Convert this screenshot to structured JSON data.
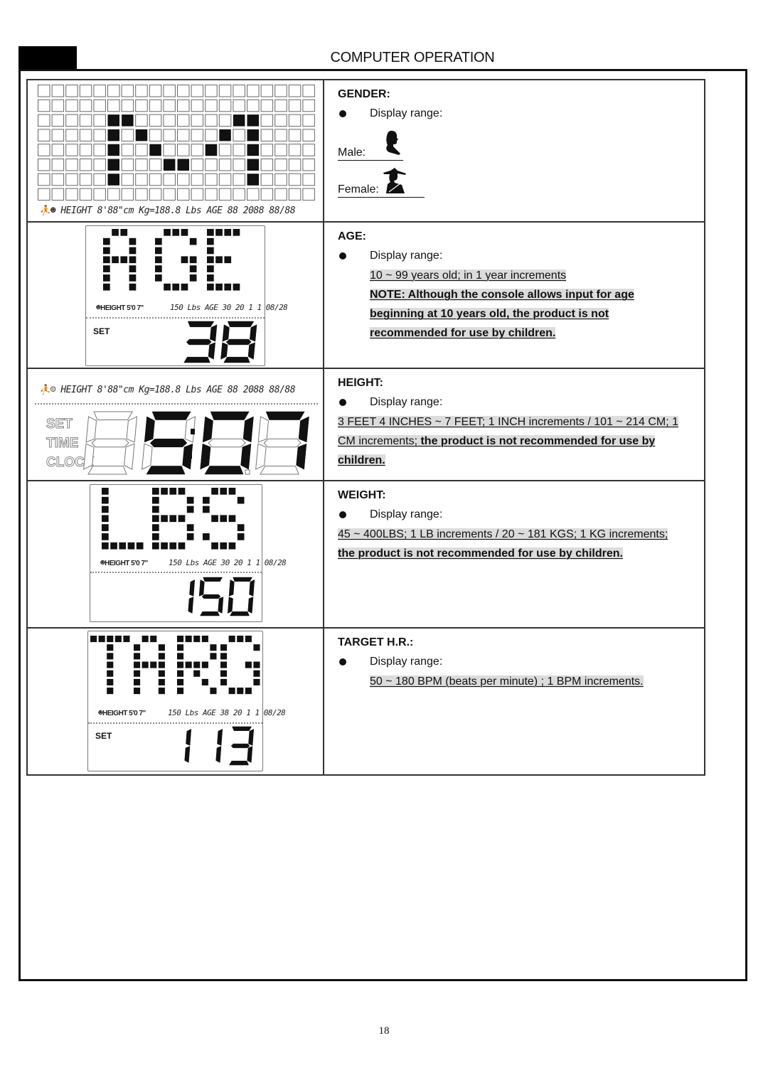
{
  "page": {
    "title": "COMPUTER OPERATION",
    "page_number": "18"
  },
  "sections": {
    "gender": {
      "title": "GENDER:",
      "bullet": "Display range:",
      "male_label": "Male:",
      "female_label": "Female:",
      "icons": [
        "male-silhouette-icon",
        "female-silhouette-icon"
      ],
      "display": {
        "matrix_rows": [
          "00000000000000000000",
          "00000000000000000000",
          "00000110000000110000",
          "00000101000001010000",
          "00000100100010010000",
          "00000100011000010000",
          "00000100000000010000",
          "00000000000000000000"
        ],
        "status_strip": "HEIGHT 8'88\"cm Kg=188.8 Lbs AGE 88 2088 88/88"
      }
    },
    "age": {
      "title": "AGE:",
      "bullet": "Display range:",
      "range": "10 ~ 99 years old; in 1 year increments",
      "note_label": "NOTE",
      "note_text": ": Although the console allows input for age beginning at 10 years old, the product is not recommended for use by children.",
      "display": {
        "word": "AGE",
        "status_left": "HEIGHT 5'0 7\"",
        "status_right": "150 Lbs AGE 30 20 1 1 08/28",
        "set_label": "SET",
        "value": "38"
      }
    },
    "height": {
      "title": "HEIGHT:",
      "bullet": "Display range:",
      "range_part1": "3 FEET 4 INCHES ~ 7 FEET; 1 INCH increments / 101 ~ 214 CM; 1 CM increments;",
      "range_part2": " the product is not recommended for use by children.",
      "display": {
        "status_strip": "HEIGHT 8'88\"cm Kg=188.8 Lbs AGE 88 2088 88/88",
        "mode_labels": [
          "SET",
          "TIME",
          "CLOCK"
        ],
        "value": "5:07"
      }
    },
    "weight": {
      "title": "WEIGHT:",
      "bullet": "Display range:",
      "range_part1": "45 ~ 400LBS; 1 LB increments / 20 ~ 181 KGS; 1 KG increments;",
      "range_part2": " the product is not recommended for use by children.",
      "display": {
        "word": "LBS",
        "status_left": "HEIGHT 5'0 7\"",
        "status_right": "150 Lbs AGE 30 20 1 1 08/28",
        "value": "150"
      }
    },
    "target_hr": {
      "title": "TARGET  H.R.:",
      "bullet": "Display range:",
      "range": "50 ~ 180 BPM (beats per minute) ; 1 BPM increments.",
      "display": {
        "word": "TARG",
        "status_left": "HEIGHT 5'0 7\"",
        "status_right": "150 Lbs AGE 38 20 1 1 08/28",
        "set_label": "SET",
        "value": "113"
      }
    }
  }
}
